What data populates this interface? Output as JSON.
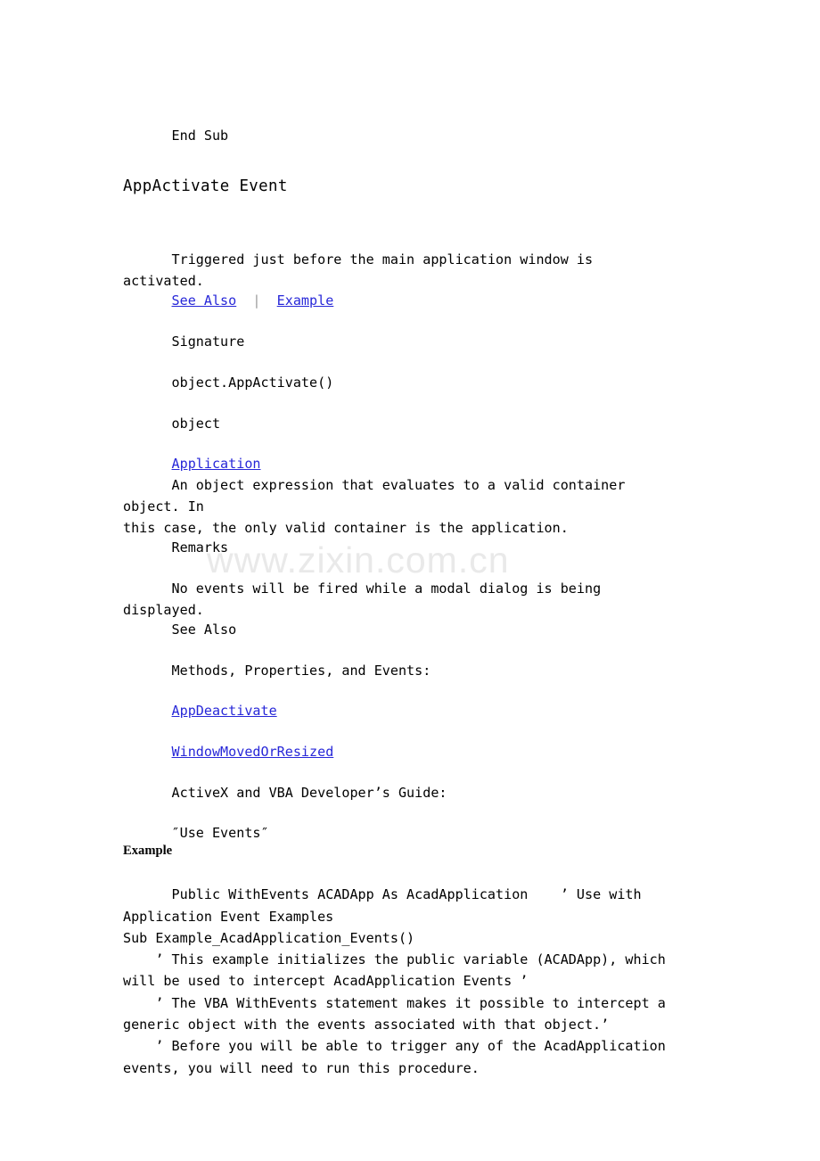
{
  "document": {
    "watermark": "www.zixin.com.cn",
    "link_color": "#2727d8",
    "text_color": "#000000",
    "separator_color": "#9a9a9a",
    "background_color": "#ffffff"
  },
  "content": {
    "end_sub": "End Sub",
    "title": "AppActivate Event",
    "description": "Triggered just before the main application window is activated.",
    "nav": {
      "see_also_link": "See Also",
      "separator": "|",
      "example_link": "Example"
    },
    "signature_label": "Signature",
    "signature_code": "object.AppActivate()",
    "object_label": "object",
    "application_link": "Application",
    "object_description": "An object expression that evaluates to a valid container object. In\nthis case, the only valid container is the application.",
    "remarks_label": "Remarks",
    "remarks_text": "No events will be fired while a modal dialog is being displayed.",
    "see_also_label": "See Also",
    "mpe_label": "Methods, Properties, and Events:",
    "link_app_deactivate": "AppDeactivate",
    "link_window_moved_or_resized": "WindowMovedOrResized",
    "guide_label": "ActiveX and VBA Developer’s Guide:",
    "guide_topic": "″Use Events″",
    "example_heading": "Example",
    "example_code": "Public WithEvents ACADApp As AcadApplication    ’ Use with\nApplication Event Examples\nSub Example_AcadApplication_Events()\n    ’ This example initializes the public variable (ACADApp), which\nwill be used to intercept AcadApplication Events ’\n    ’ The VBA WithEvents statement makes it possible to intercept a\ngeneric object with the events associated with that object.’\n    ’ Before you will be able to trigger any of the AcadApplication\nevents, you will need to run this procedure."
  }
}
